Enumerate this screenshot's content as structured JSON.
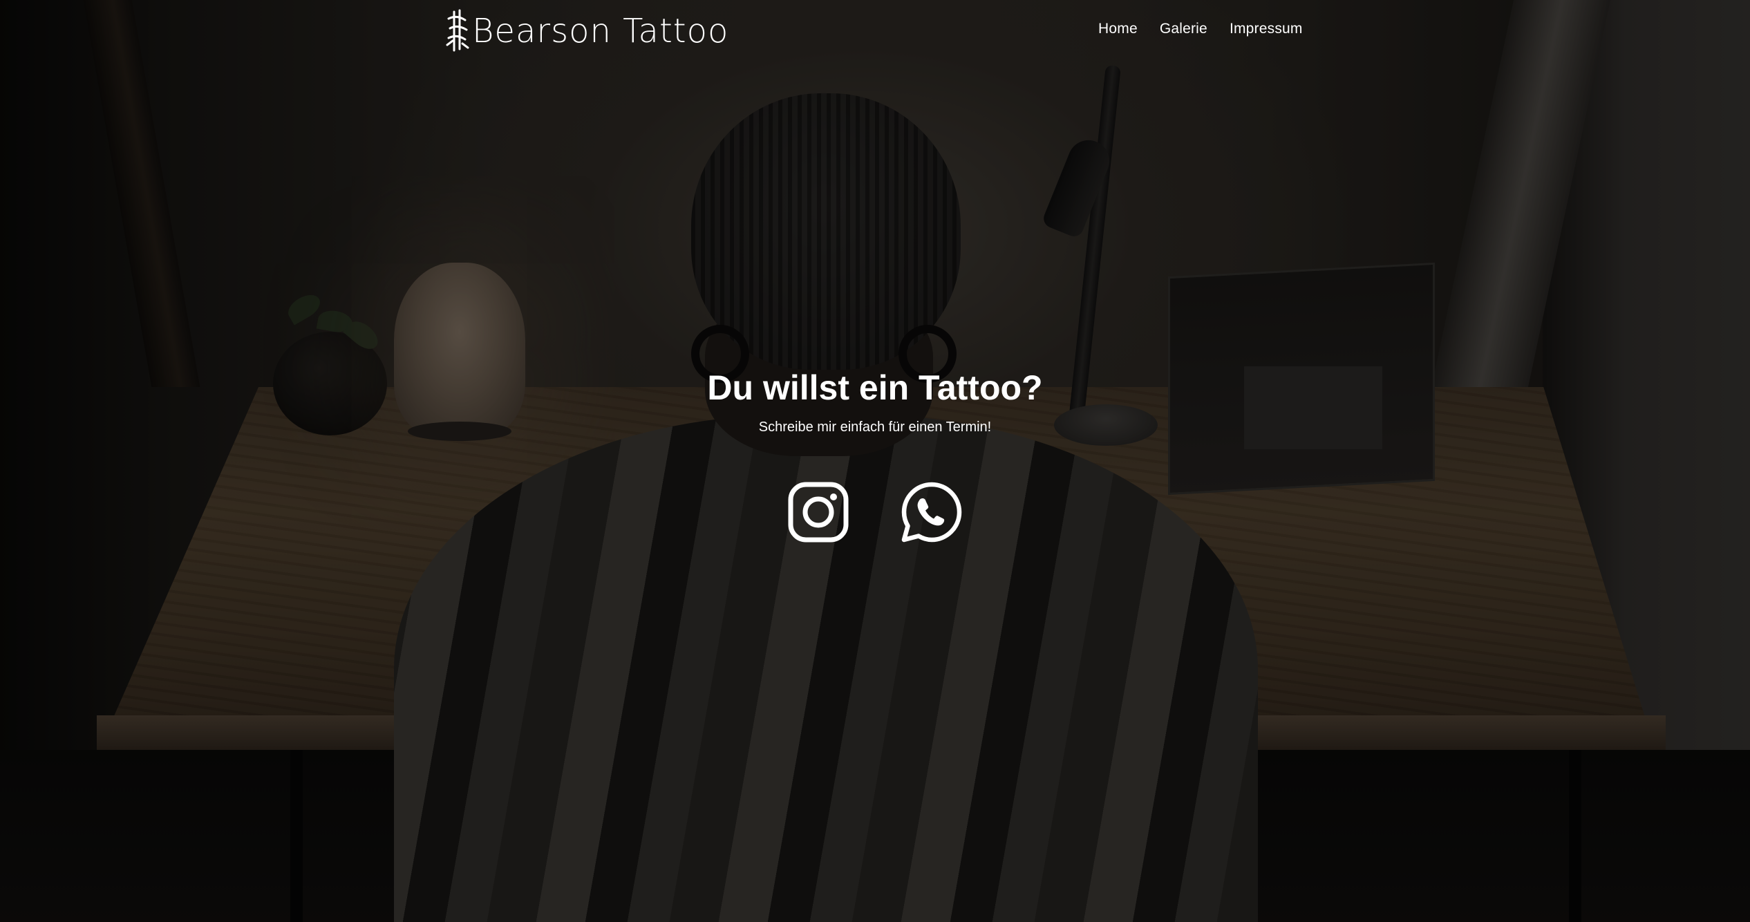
{
  "brand": {
    "logo_text": "Bearson Tattoo",
    "logo_icon": "bear-sigil-icon"
  },
  "nav": {
    "items": [
      {
        "label": "Home"
      },
      {
        "label": "Galerie"
      },
      {
        "label": "Impressum"
      }
    ]
  },
  "hero": {
    "title": "Du willst ein Tattoo?",
    "subtitle": "Schreibe mir einfach für einen Termin!"
  },
  "socials": [
    {
      "icon": "instagram-icon"
    },
    {
      "icon": "whatsapp-icon"
    }
  ],
  "colors": {
    "text": "#ffffff",
    "overlay": "rgba(0,0,0,0.45)"
  }
}
